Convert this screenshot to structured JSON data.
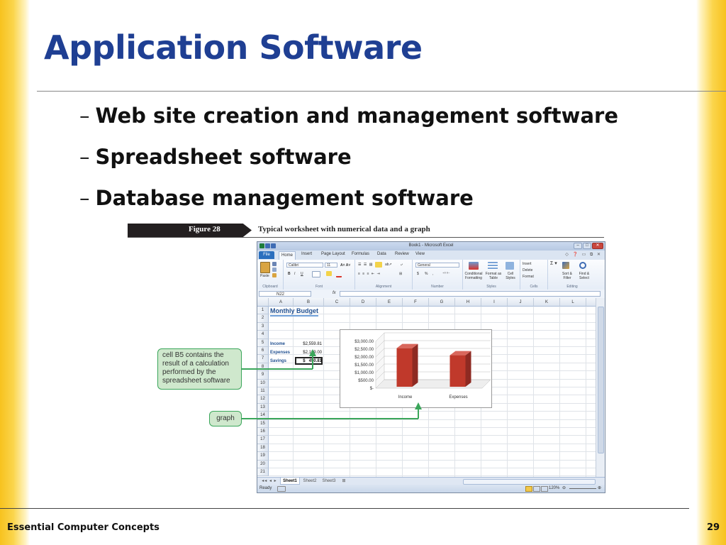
{
  "slide": {
    "title": "Application Software",
    "bullets": [
      "Web site creation and management software",
      "Spreadsheet software",
      "Database management software"
    ],
    "bullet_marker": "–",
    "footer": "Essential Computer Concepts",
    "page_number": "29"
  },
  "figure": {
    "number": "Figure 28",
    "caption": "Typical worksheet with numerical data and a graph"
  },
  "excel": {
    "window_title": "Book1 - Microsoft Excel",
    "tabs": [
      "File",
      "Home",
      "Insert",
      "Page Layout",
      "Formulas",
      "Data",
      "Review",
      "View"
    ],
    "ribbon": {
      "clipboard": {
        "label": "Clipboard",
        "paste": "Paste"
      },
      "font": {
        "label": "Font",
        "font_name": "Calibri",
        "font_size": "11",
        "bold": "B",
        "italic": "I",
        "underline": "U"
      },
      "alignment": {
        "label": "Alignment"
      },
      "number": {
        "label": "Number",
        "format": "General",
        "currency": "$",
        "percent": "%",
        "comma": ","
      },
      "styles": {
        "label": "Styles",
        "conditional": "Conditional Formatting",
        "format_table": "Format as Table",
        "cell_styles": "Cell Styles"
      },
      "cells": {
        "label": "Cells",
        "insert": "Insert",
        "delete": "Delete",
        "format": "Format"
      },
      "editing": {
        "label": "Editing",
        "sort_filter": "Sort & Filter",
        "find_select": "Find & Select"
      }
    },
    "name_box": "N22",
    "fx": "fx",
    "columns": [
      "A",
      "B",
      "C",
      "D",
      "E",
      "F",
      "G",
      "H",
      "I",
      "J",
      "K",
      "L"
    ],
    "rows": [
      "1",
      "2",
      "3",
      "4",
      "5",
      "6",
      "7",
      "8",
      "9",
      "10",
      "11",
      "12",
      "13",
      "14",
      "15",
      "16",
      "17",
      "18",
      "19",
      "20",
      "21"
    ],
    "cells": {
      "A1": "Monthly Budget",
      "A3": "Income",
      "B3": "$2,559.81",
      "A4": "Expenses",
      "B4": "$2,109.00",
      "A5": "Savings",
      "B5": "$   450.81"
    },
    "sheet_tabs": [
      "Sheet1",
      "Sheet2",
      "Sheet3"
    ],
    "status": "Ready",
    "zoom": "120%"
  },
  "chart_data": {
    "type": "bar",
    "categories": [
      "Income",
      "Expenses"
    ],
    "values": [
      2559.81,
      2109.0
    ],
    "ylim": [
      0,
      3000
    ],
    "y_ticks": [
      "$3,000.00",
      "$2,500.00",
      "$2,000.00",
      "$1,500.00",
      "$1,000.00",
      "$500.00",
      "$-"
    ],
    "bar_color": "#c0392b",
    "legend": "none",
    "grid": true,
    "style": "3d"
  },
  "callouts": {
    "b5": "cell B5 contains the result of a calculation performed by the spreadsheet software",
    "graph": "graph",
    "color": "#3aa65a"
  }
}
